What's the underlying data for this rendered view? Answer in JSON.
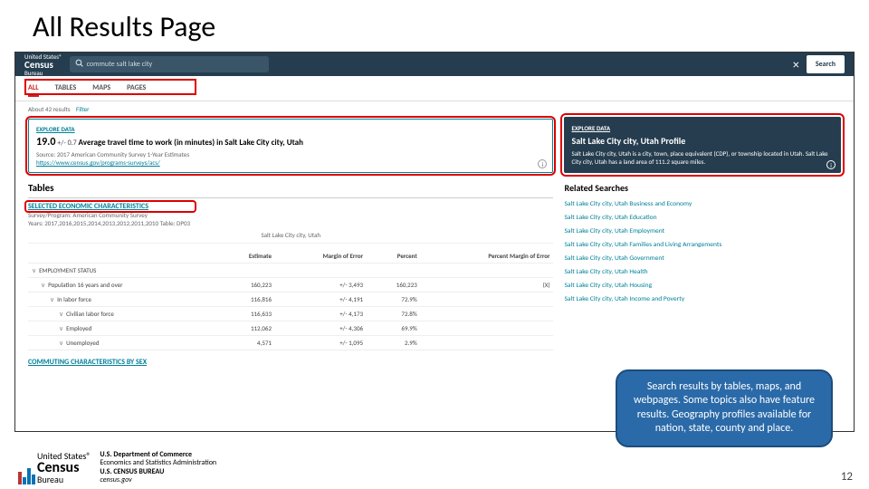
{
  "slide": {
    "title": "All Results Page",
    "page_number": "12"
  },
  "topbar": {
    "logo_top": "United States®",
    "logo_main": "Census",
    "logo_sub": "Bureau",
    "search_value": "commute salt lake city",
    "search_button": "Search"
  },
  "tabs": {
    "items": [
      "ALL",
      "TABLES",
      "MAPS",
      "PAGES"
    ],
    "active": 0
  },
  "filter_row": {
    "count_label": "About 42 results",
    "filter_label": "Filter"
  },
  "feature": {
    "explore": "EXPLORE DATA",
    "value": "19.0",
    "moe": "+/- 0.7",
    "title": "Average travel time to work (in minutes) in Salt Lake City city, Utah",
    "source": "Source: 2017 American Community Survey 1-Year Estimates",
    "url": "https://www.census.gov/programs-surveys/acs/"
  },
  "tables_section": {
    "heading": "Tables",
    "title": "SELECTED ECONOMIC CHARACTERISTICS",
    "program": "Survey/Program: American Community Survey",
    "years": "Years: 2017,2016,2015,2014,2013,2012,2011,2010   Table: DP03",
    "geo_header": "Salt Lake City city, Utah",
    "columns": [
      "",
      "Estimate",
      "Margin of Error",
      "Percent",
      "Percent Margin of Error"
    ],
    "rows": [
      {
        "label": "EMPLOYMENT STATUS",
        "indent": 0,
        "vals": [
          "",
          "",
          "",
          ""
        ]
      },
      {
        "label": "Population 16 years and over",
        "indent": 1,
        "vals": [
          "160,223",
          "+/- 3,493",
          "160,223",
          "(X)"
        ]
      },
      {
        "label": "In labor force",
        "indent": 2,
        "vals": [
          "116,816",
          "+/- 4,191",
          "72.9%",
          ""
        ]
      },
      {
        "label": "Civilian labor force",
        "indent": 3,
        "vals": [
          "116,633",
          "+/- 4,173",
          "72.8%",
          ""
        ]
      },
      {
        "label": "Employed",
        "indent": 3,
        "vals": [
          "112,062",
          "+/- 4,306",
          "69.9%",
          ""
        ]
      },
      {
        "label": "Unemployed",
        "indent": 3,
        "vals": [
          "4,571",
          "+/- 1,095",
          "2.9%",
          ""
        ]
      }
    ],
    "next_table": "COMMUTING CHARACTERISTICS BY SEX"
  },
  "profile": {
    "explore": "EXPLORE DATA",
    "title": "Salt Lake City city, Utah Profile",
    "desc": "Salt Lake City city, Utah is a city, town, place equivalent (CDP), or township located in Utah. Salt Lake City city, Utah has a land area of 111.2 square miles."
  },
  "related": {
    "heading": "Related Searches",
    "items": [
      "Salt Lake City city, Utah Business and Economy",
      "Salt Lake City city, Utah Education",
      "Salt Lake City city, Utah Employment",
      "Salt Lake City city, Utah Families and Living Arrangements",
      "Salt Lake City city, Utah Government",
      "Salt Lake City city, Utah Health",
      "Salt Lake City city, Utah Housing",
      "Salt Lake City city, Utah Income and Poverty"
    ]
  },
  "callout": "Search results by tables, maps, and webpages. Some topics also have feature results. Geography profiles available for nation, state, county and place.",
  "footer": {
    "logo_top": "United States®",
    "logo_main": "Census",
    "logo_sub": "Bureau",
    "line1": "U.S. Department of Commerce",
    "line2": "Economics and Statistics Administration",
    "line3": "U.S. CENSUS BUREAU",
    "line4": "census.gov"
  }
}
